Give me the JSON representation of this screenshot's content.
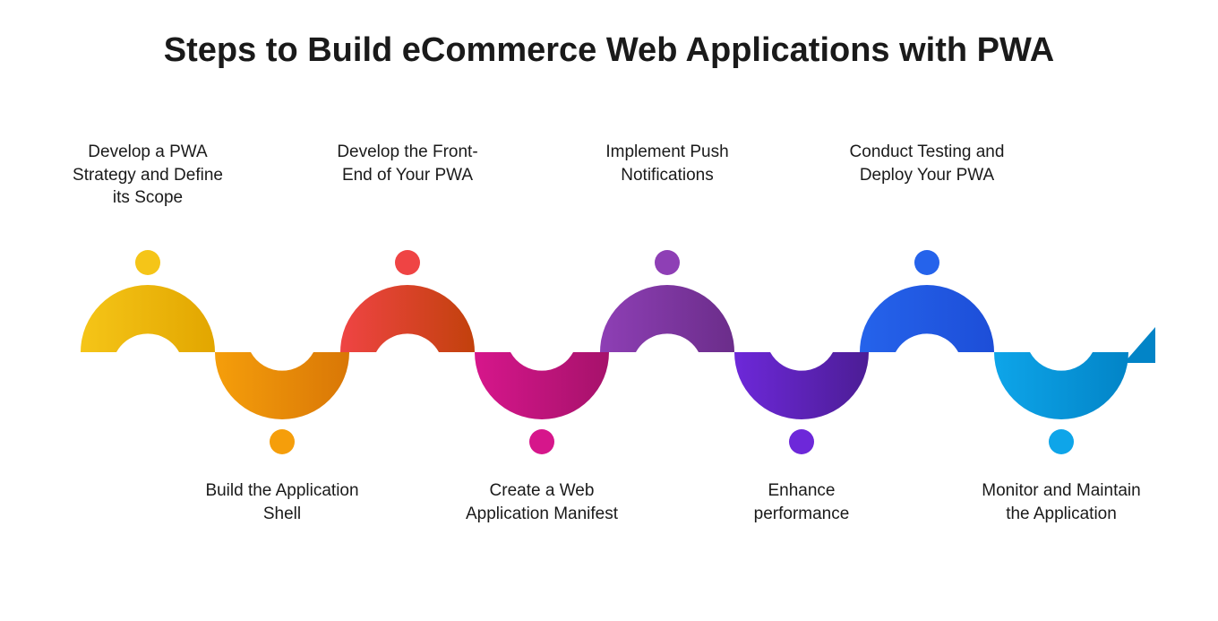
{
  "title": "Steps to Build eCommerce Web Applications with PWA",
  "steps": {
    "s1": "Develop a PWA Strategy and Define its Scope",
    "s2": "Build the Application Shell",
    "s3": "Develop the Front-End of Your PWA",
    "s4": "Create a Web Application Manifest",
    "s5": "Implement Push Notifications",
    "s6": "Enhance performance",
    "s7": "Conduct Testing and Deploy Your PWA",
    "s8": "Monitor and Maintain the Application"
  },
  "colors": {
    "c1a": "#F5C518",
    "c1b": "#E2A600",
    "c2a": "#F59E0B",
    "c2b": "#D97706",
    "c3a": "#EF4444",
    "c3b": "#C2410C",
    "c4a": "#D6168B",
    "c4b": "#A6126B",
    "c5a": "#8E3FB5",
    "c5b": "#6B2D8A",
    "c6a": "#6D28D9",
    "c6b": "#4C1D95",
    "c7a": "#2563EB",
    "c7b": "#1D4ED8",
    "c8a": "#0EA5E9",
    "c8b": "#0284C7"
  }
}
